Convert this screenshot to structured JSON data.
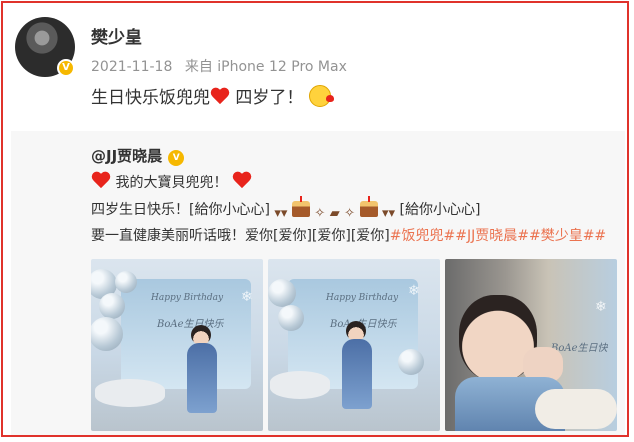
{
  "post": {
    "author": "樊少皇",
    "date": "2021-11-18",
    "source": "来自 iPhone 12 Pro Max",
    "text_part1": "生日快乐饭兜兜",
    "text_part2": " 四岁了！",
    "avatar_badge": "V"
  },
  "repost": {
    "author": "@JJ贾晓晨",
    "badge": "V",
    "line1": "我的大寶貝兜兜！",
    "line2_a": "四岁生日快乐！[給你小心心]",
    "line2_b": "[給你小心心]",
    "line3_plain": "要一直健康美丽听话哦！爱你[爱你][爱你][爱你]",
    "line3_tags": "#饭兜兜##JJ贾晓晨##樊少皇##",
    "photo_caption": "Happy Birthday",
    "photo_text": "BoAe生日快乐"
  },
  "icons": {
    "heart": "heart-emoji",
    "kiss": "kiss-face-emoji",
    "cake": "cake-emoji",
    "verified": "verified-badge-icon"
  },
  "colors": {
    "frame": "#e0322b",
    "tag": "#eb7350",
    "verified": "#f6b800"
  }
}
